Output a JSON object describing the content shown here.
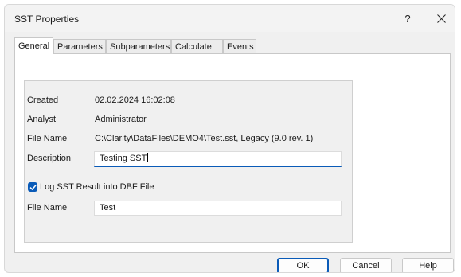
{
  "window": {
    "title": "SST Properties",
    "help_label": "?"
  },
  "tabs": [
    {
      "label": "General",
      "active": true
    },
    {
      "label": "Parameters",
      "active": false
    },
    {
      "label": "Subparameters",
      "active": false
    },
    {
      "label": "Calculate By",
      "active": false
    },
    {
      "label": "Events",
      "active": false
    }
  ],
  "general": {
    "created_label": "Created",
    "created_value": "02.02.2024 16:02:08",
    "analyst_label": "Analyst",
    "analyst_value": "Administrator",
    "file_name_label": "File Name",
    "file_name_value": "C:\\Clarity\\DataFiles\\DEMO4\\Test.sst, Legacy (9.0 rev. 1)",
    "description_label": "Description",
    "description_value": "Testing SST",
    "log_checkbox_label": "Log SST Result into DBF File",
    "log_checked": true,
    "dbf_file_name_label": "File Name",
    "dbf_file_name_value": "Test"
  },
  "buttons": {
    "ok": "OK",
    "cancel": "Cancel",
    "help": "Help"
  },
  "colors": {
    "accent": "#0a5bb8",
    "dialog_bg": "#f0f0f0"
  }
}
